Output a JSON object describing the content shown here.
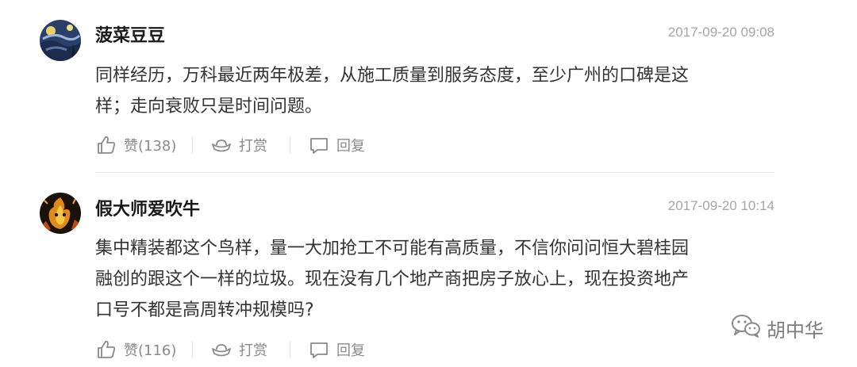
{
  "comments": [
    {
      "username": "菠菜豆豆",
      "timestamp": "2017-09-20 09:08",
      "content_lines": [
        "同样经历，万科最近两年极差，从施工质量到服务态度，至少广州的口碑是这",
        "样；走向衰败只是时间问题。"
      ],
      "like_label": "赞(138)",
      "reward_label": "打赏",
      "reply_label": "回复",
      "avatar_icon": "starry-night-avatar"
    },
    {
      "username": "假大师爱吹牛",
      "timestamp": "2017-09-20 10:14",
      "content_lines": [
        "集中精装都这个鸟样，量一大加抢工不可能有高质量，不信你问问恒大碧桂园",
        "融创的跟这个一样的垃圾。现在没有几个地产商把房子放心上，现在投资地产",
        "口号不都是高周转冲规模吗?"
      ],
      "like_label": "赞(116)",
      "reward_label": "打赏",
      "reply_label": "回复",
      "avatar_icon": "flame-character-avatar"
    }
  ],
  "watermark": {
    "text": "胡中华",
    "icon": "wechat-icon"
  },
  "colors": {
    "username": "#1a1a1a",
    "content": "#333333",
    "meta": "#a7a7a7",
    "action": "#8b8b8b"
  }
}
